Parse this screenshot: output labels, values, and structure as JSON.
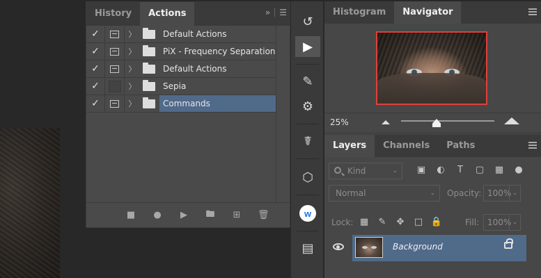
{
  "actions_panel": {
    "tabs": [
      {
        "label": "History",
        "active": false
      },
      {
        "label": "Actions",
        "active": true
      }
    ],
    "rows": [
      {
        "label": "Default Actions",
        "checked": true,
        "dialog": true,
        "selected": false
      },
      {
        "label": "PiX - Frequency Separation",
        "checked": true,
        "dialog": true,
        "selected": false
      },
      {
        "label": "Default Actions",
        "checked": true,
        "dialog": true,
        "selected": false
      },
      {
        "label": "Sepia",
        "checked": true,
        "dialog": false,
        "selected": false
      },
      {
        "label": "Commands",
        "checked": true,
        "dialog": true,
        "selected": true
      }
    ],
    "footer_icons": [
      "stop-icon",
      "record-icon",
      "play-icon",
      "folder-icon",
      "new-action-icon",
      "trash-icon"
    ]
  },
  "toolbar": {
    "tools": [
      "history-tool-icon",
      "play-tool-icon",
      "brush-list-icon",
      "adjust-icon",
      "stamp-list-icon",
      "cube-icon",
      "w-plugin-icon",
      "plugin-icon"
    ],
    "w_label": "w"
  },
  "navigator_panel": {
    "tabs": [
      {
        "label": "Histogram",
        "active": false
      },
      {
        "label": "Navigator",
        "active": true
      }
    ],
    "zoom": "25%",
    "slider_level": 0.37
  },
  "layers_panel": {
    "tabs": [
      {
        "label": "Layers",
        "active": true
      },
      {
        "label": "Channels",
        "active": false
      },
      {
        "label": "Paths",
        "active": false
      }
    ],
    "filter_placeholder": "Kind",
    "blend_mode": "Normal",
    "opacity_label": "Opacity:",
    "opacity_value": "100%",
    "lock_label": "Lock:",
    "fill_label": "Fill:",
    "fill_value": "100%",
    "layers": [
      {
        "name": "Background",
        "locked": true,
        "visible": true
      }
    ]
  },
  "colors": {
    "selection": "#506a8a",
    "navigator_box": "#e0403a"
  }
}
